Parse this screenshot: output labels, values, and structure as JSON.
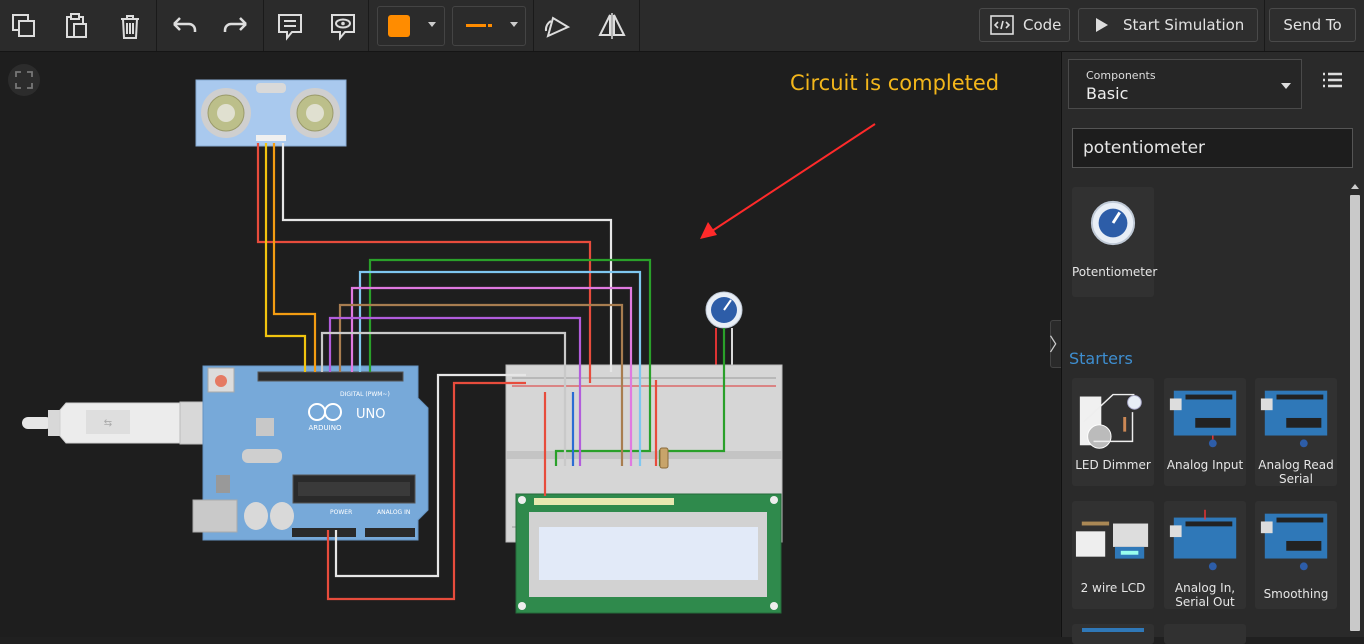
{
  "toolbar": {
    "fill_color": "#ff8c00",
    "wire_color": "#ff8c00",
    "code_label": "Code",
    "start_label": "Start Simulation",
    "send_label": "Send To"
  },
  "canvas": {
    "annotation": "Circuit is completed",
    "arduino": {
      "brand": "ARDUINO",
      "model": "UNO",
      "digital_label": "DIGITAL (PWM~)",
      "power_label": "POWER",
      "analog_label": "ANALOG IN"
    }
  },
  "panel": {
    "components_label": "Components",
    "components_value": "Basic",
    "search_value": "potentiometer",
    "results": [
      {
        "label": "Potentiometer"
      }
    ],
    "starters_title": "Starters",
    "starters": [
      {
        "label": "LED Dimmer"
      },
      {
        "label": "Analog Input"
      },
      {
        "label": "Analog Read Serial"
      },
      {
        "label": "2 wire LCD"
      },
      {
        "label": "Analog In, Serial Out"
      },
      {
        "label": "Smoothing"
      }
    ]
  }
}
